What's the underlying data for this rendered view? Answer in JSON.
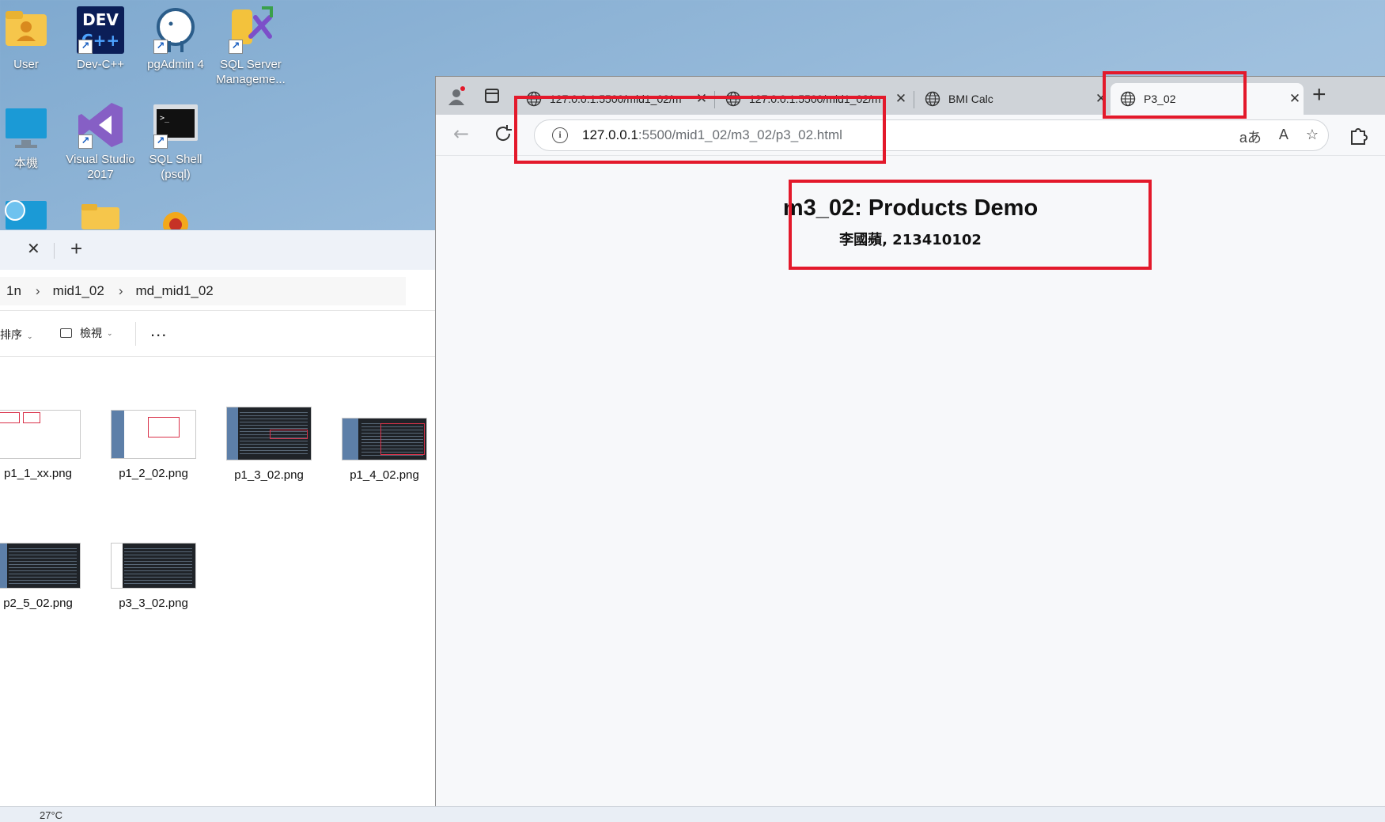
{
  "desktop": {
    "icons": [
      {
        "label": "User"
      },
      {
        "label": "Dev-C++"
      },
      {
        "label": "pgAdmin 4"
      },
      {
        "label": "SQL Server Manageme..."
      },
      {
        "label": "本機"
      },
      {
        "label": "Visual Studio 2017"
      },
      {
        "label": "SQL Shell (psql)"
      }
    ]
  },
  "explorer": {
    "breadcrumb": [
      "1n",
      "mid1_02",
      "md_mid1_02"
    ],
    "commands": {
      "sort_label": "排序",
      "view_label": "檢視",
      "more_label": "..."
    },
    "files": [
      {
        "name": "p1_1_xx.png"
      },
      {
        "name": "p1_2_02.png"
      },
      {
        "name": "p1_3_02.png"
      },
      {
        "name": "p1_4_02.png"
      },
      {
        "name": "p2_5_02.png"
      },
      {
        "name": "p3_3_02.png"
      }
    ]
  },
  "browser": {
    "tabs": [
      {
        "title": "127.0.0.1:5500/mid1_02/m"
      },
      {
        "title": "127.0.0.1:5500/mid1_02/m"
      },
      {
        "title": "BMI Calc"
      },
      {
        "title": "P3_02"
      }
    ],
    "address": {
      "host": "127.0.0.1",
      "path": ":5500/mid1_02/m3_02/p3_02.html"
    },
    "omnibox_icons": {
      "translate": "aあ",
      "read_aloud": "A",
      "favorite": "☆"
    }
  },
  "page": {
    "title": "m3_02: Products Demo",
    "subtitle": "李國蘋, 213410102"
  },
  "taskbar": {
    "weather": "27°C"
  },
  "colors": {
    "annotation": "#e3192b",
    "desktop": "#9fc0de",
    "tabstrip": "#cfd3d8"
  }
}
